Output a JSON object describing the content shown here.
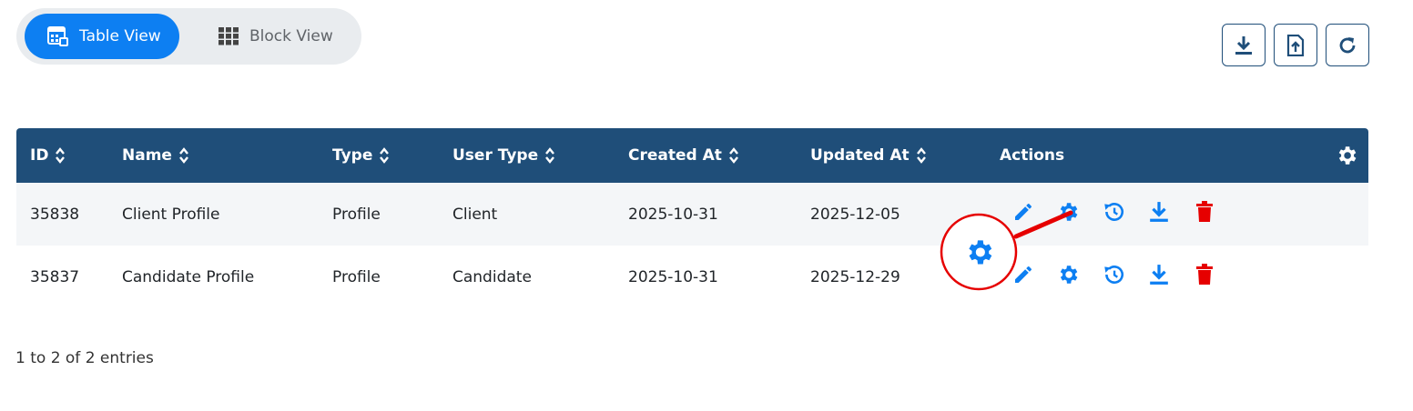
{
  "view_toggle": {
    "table_view_label": "Table View",
    "block_view_label": "Block View",
    "active": "table"
  },
  "toolbar": {
    "buttons": [
      "download-icon",
      "export-file-icon",
      "refresh-icon"
    ]
  },
  "table": {
    "columns": [
      "ID",
      "Name",
      "Type",
      "User Type",
      "Created At",
      "Updated At",
      "Actions"
    ],
    "rows": [
      {
        "id": "35838",
        "name": "Client Profile",
        "type": "Profile",
        "user_type": "Client",
        "created_at": "2025-10-31",
        "updated_at": "2025-12-05"
      },
      {
        "id": "35837",
        "name": "Candidate Profile",
        "type": "Profile",
        "user_type": "Candidate",
        "created_at": "2025-10-31",
        "updated_at": "2025-12-29"
      }
    ],
    "row_actions": [
      "edit-icon",
      "settings-icon",
      "history-icon",
      "download-icon",
      "delete-icon"
    ]
  },
  "footer": {
    "entries_text": "1 to 2 of 2 entries"
  },
  "colors": {
    "primary": "#0d7ff2",
    "header_bg": "#1f4e79",
    "delete": "#e60000",
    "annotation": "#e60000"
  }
}
